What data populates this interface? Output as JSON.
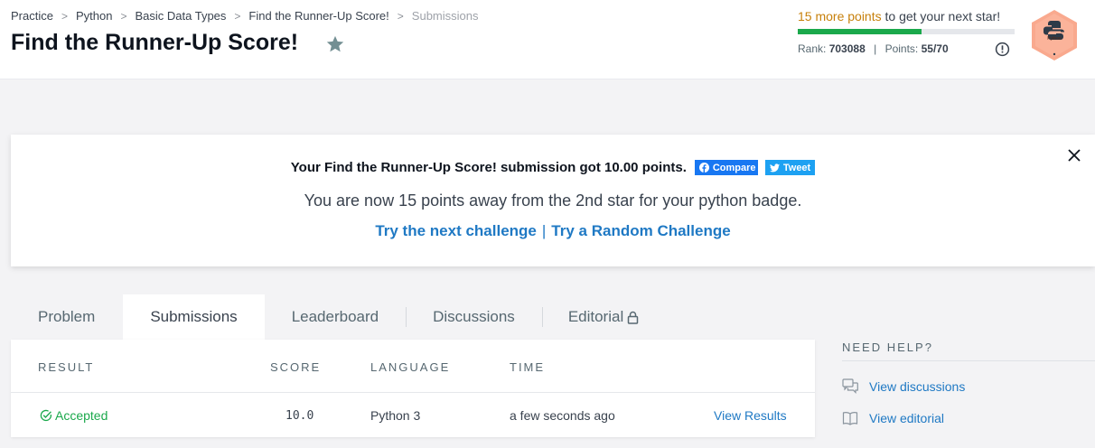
{
  "breadcrumb": {
    "items": [
      "Practice",
      "Python",
      "Basic Data Types",
      "Find the Runner-Up Score!"
    ],
    "current": "Submissions"
  },
  "page": {
    "title": "Find the Runner-Up Score!"
  },
  "progress": {
    "points_text": "15 more points",
    "suffix": " to get your next star!",
    "fill_fraction": 0.57,
    "rank_label": "Rank:",
    "rank_value": "703088",
    "points_label": "Points:",
    "points_value": "55/70"
  },
  "badge": {
    "label": "Python",
    "color": "#f9a98e"
  },
  "banner": {
    "message": "Your Find the Runner-Up Score! submission got 10.00 points.",
    "share_facebook": "Compare",
    "share_twitter": "Tweet",
    "subtext": "You are now 15 points away from the 2nd star for your python badge.",
    "next_challenge": "Try the next challenge",
    "separator": "|",
    "random_challenge": "Try a Random Challenge"
  },
  "tabs": [
    {
      "label": "Problem"
    },
    {
      "label": "Submissions"
    },
    {
      "label": "Leaderboard"
    },
    {
      "label": "Discussions"
    },
    {
      "label": "Editorial"
    }
  ],
  "table": {
    "headers": {
      "result": "RESULT",
      "score": "SCORE",
      "language": "LANGUAGE",
      "time": "TIME"
    },
    "rows": [
      {
        "result": "Accepted",
        "score": "10.0",
        "language": "Python 3",
        "time": "a few seconds ago",
        "action": "View Results"
      }
    ]
  },
  "help": {
    "title": "NEED HELP?",
    "items": [
      {
        "label": "View discussions",
        "icon": "discussions-icon"
      },
      {
        "label": "View editorial",
        "icon": "book-icon"
      }
    ]
  },
  "colors": {
    "accent_green": "#1ba94c",
    "link_blue": "#1f79c4",
    "points_orange": "#c7800b"
  }
}
